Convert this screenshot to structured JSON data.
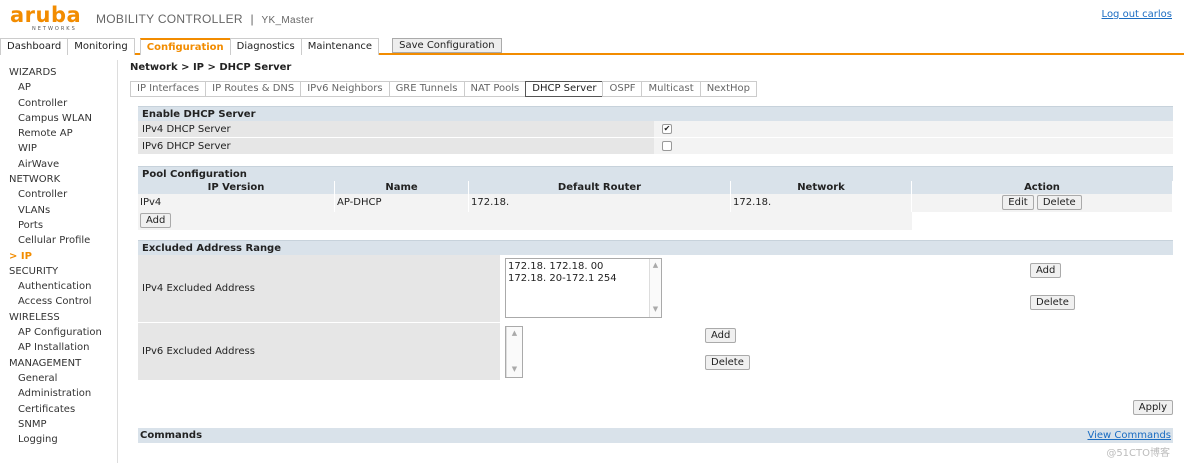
{
  "header": {
    "logo": "aruba",
    "logo_sub": "NETWORKS",
    "product": "MOBILITY CONTROLLER",
    "separator": "|",
    "controller_name": "YK_Master",
    "logout": "Log out carlos"
  },
  "top_tabs": [
    "Dashboard",
    "Monitoring",
    "Configuration",
    "Diagnostics",
    "Maintenance"
  ],
  "top_tab_active": "Configuration",
  "save_config": "Save Configuration",
  "sidebar": {
    "wizards": {
      "title": "WIZARDS",
      "items": [
        "AP",
        "Controller",
        "Campus WLAN",
        "Remote AP",
        "WIP",
        "AirWave"
      ]
    },
    "network": {
      "title": "NETWORK",
      "items": [
        "Controller",
        "VLANs",
        "Ports",
        "Cellular Profile"
      ],
      "active": "> IP"
    },
    "security": {
      "title": "SECURITY",
      "items": [
        "Authentication",
        "Access Control"
      ]
    },
    "wireless": {
      "title": "WIRELESS",
      "items": [
        "AP Configuration",
        "AP Installation"
      ]
    },
    "management": {
      "title": "MANAGEMENT",
      "items": [
        "General",
        "Administration",
        "Certificates",
        "SNMP",
        "Logging"
      ]
    }
  },
  "breadcrumb": "Network > IP > DHCP Server",
  "sub_tabs": [
    "IP Interfaces",
    "IP Routes & DNS",
    "IPv6 Neighbors",
    "GRE Tunnels",
    "NAT Pools",
    "DHCP Server",
    "OSPF",
    "Multicast",
    "NextHop"
  ],
  "sub_tab_active": "DHCP Server",
  "enable_section": {
    "title": "Enable DHCP Server",
    "ipv4_label": "IPv4 DHCP Server",
    "ipv4_checked": "✔",
    "ipv6_label": "IPv6 DHCP Server"
  },
  "pool": {
    "title": "Pool Configuration",
    "headers": [
      "IP Version",
      "Name",
      "Default Router",
      "Network",
      "Action"
    ],
    "row": {
      "version": "IPv4",
      "name": "AP-DHCP",
      "router": "172.18.",
      "network": "172.18."
    },
    "edit": "Edit",
    "delete": "Delete",
    "add": "Add"
  },
  "excluded": {
    "title": "Excluded Address Range",
    "ipv4_label": "IPv4 Excluded Address",
    "ipv4_lines": [
      "172.18.   172.18.   00",
      "172.18.   20-172.1   254"
    ],
    "ipv6_label": "IPv6 Excluded Address",
    "add": "Add",
    "delete": "Delete"
  },
  "apply": "Apply",
  "commands": {
    "title": "Commands",
    "link": "View Commands"
  },
  "watermark": "@51CTO博客",
  "colors": {
    "accent": "#f28c00",
    "section_bg": "#d9e2ea",
    "link": "#1a6cc2"
  }
}
